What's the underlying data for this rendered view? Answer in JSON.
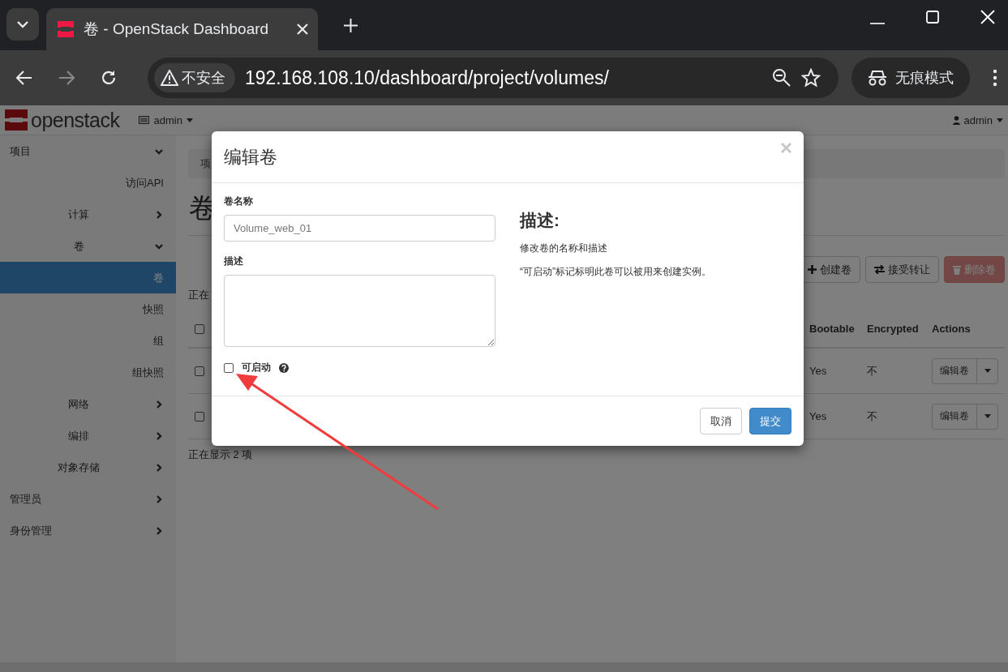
{
  "browser": {
    "tab_title": "卷 - OpenStack Dashboard",
    "security_label": "不安全",
    "url": "192.168.108.10/dashboard/project/volumes/",
    "incognito_label": "无痕模式"
  },
  "navbar": {
    "brand": "openstack",
    "project": "admin",
    "user": "admin"
  },
  "sidebar": {
    "items": [
      {
        "label": "项目",
        "expanded": true,
        "children": [
          {
            "label": "访问API",
            "selected": false
          },
          {
            "label": "计算",
            "expanded": false
          },
          {
            "label": "卷",
            "expanded": true,
            "children": [
              {
                "label": "卷",
                "selected": true
              },
              {
                "label": "快照",
                "selected": false
              },
              {
                "label": "组",
                "selected": false
              },
              {
                "label": "组快照",
                "selected": false
              }
            ]
          },
          {
            "label": "网络",
            "expanded": false
          },
          {
            "label": "编排",
            "expanded": false
          },
          {
            "label": "对象存储",
            "expanded": false
          }
        ]
      },
      {
        "label": "管理员",
        "expanded": false
      },
      {
        "label": "身份管理",
        "expanded": false
      }
    ]
  },
  "content": {
    "breadcrumb": "项",
    "title": "卷",
    "actions": [
      {
        "label": "创建卷",
        "kind": "create",
        "disabled": false
      },
      {
        "label": "接受转让",
        "kind": "transfer",
        "disabled": false
      },
      {
        "label": "删除卷",
        "kind": "delete",
        "disabled": true
      }
    ],
    "status": "正在",
    "table": {
      "columns": [
        "Bootable",
        "Encrypted",
        "Actions"
      ],
      "header_checked": false,
      "rows": [
        {
          "checked": false,
          "bootable": "Yes",
          "encrypted": "不",
          "action": "编辑卷"
        },
        {
          "checked": false,
          "bootable": "Yes",
          "encrypted": "不",
          "action": "编辑卷"
        }
      ]
    },
    "footer": "正在显示 2 项"
  },
  "modal": {
    "title": "编辑卷",
    "name_label": "卷名称",
    "name_value": "Volume_web_01",
    "description_label": "描述",
    "bootable_label": "可启动",
    "bootable_checked": false,
    "help_heading": "描述:",
    "help_lines": [
      "修改卷的名称和描述",
      "“可启动”标记标明此卷可以被用来创建实例。"
    ],
    "buttons": [
      {
        "label": "取消",
        "kind": "cancel"
      },
      {
        "label": "提交",
        "kind": "submit"
      }
    ]
  }
}
